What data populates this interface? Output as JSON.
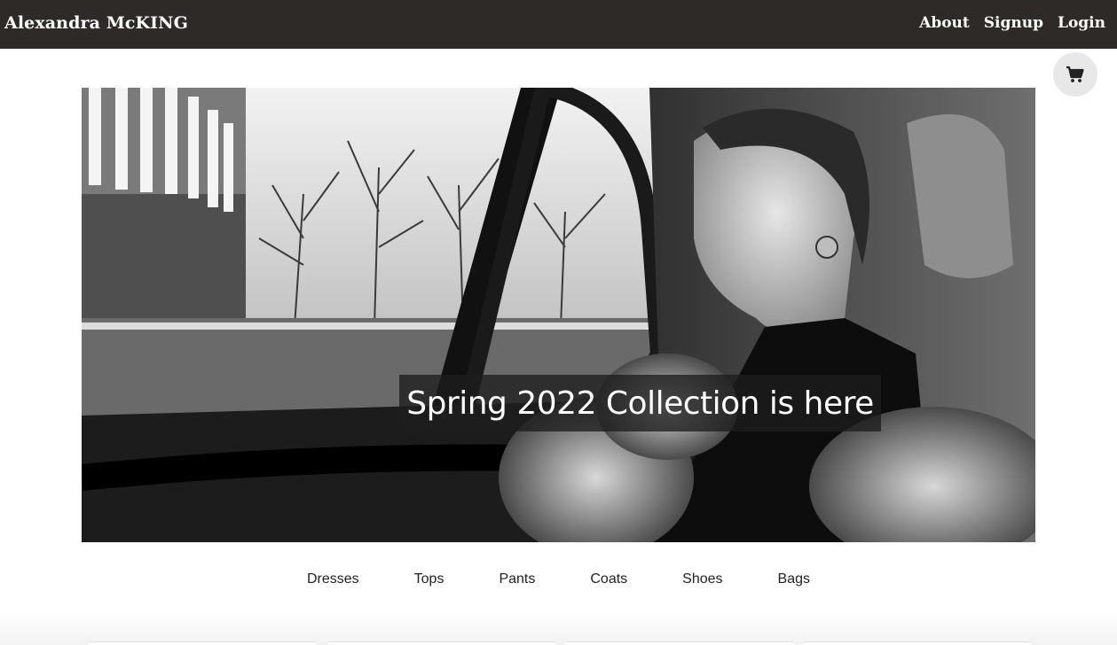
{
  "header": {
    "brand": "Alexandra McKING",
    "links": [
      "About",
      "Signup",
      "Login"
    ]
  },
  "cart": {
    "icon": "shopping-cart-icon"
  },
  "hero": {
    "caption": "Spring 2022 Collection is here"
  },
  "categories": [
    "Dresses",
    "Tops",
    "Pants",
    "Coats",
    "Shoes",
    "Bags"
  ],
  "colors": {
    "nav_background": "#2e2a28",
    "nav_text": "#ffffff",
    "caption_background": "#1e1e1e",
    "category_text": "#222222"
  }
}
